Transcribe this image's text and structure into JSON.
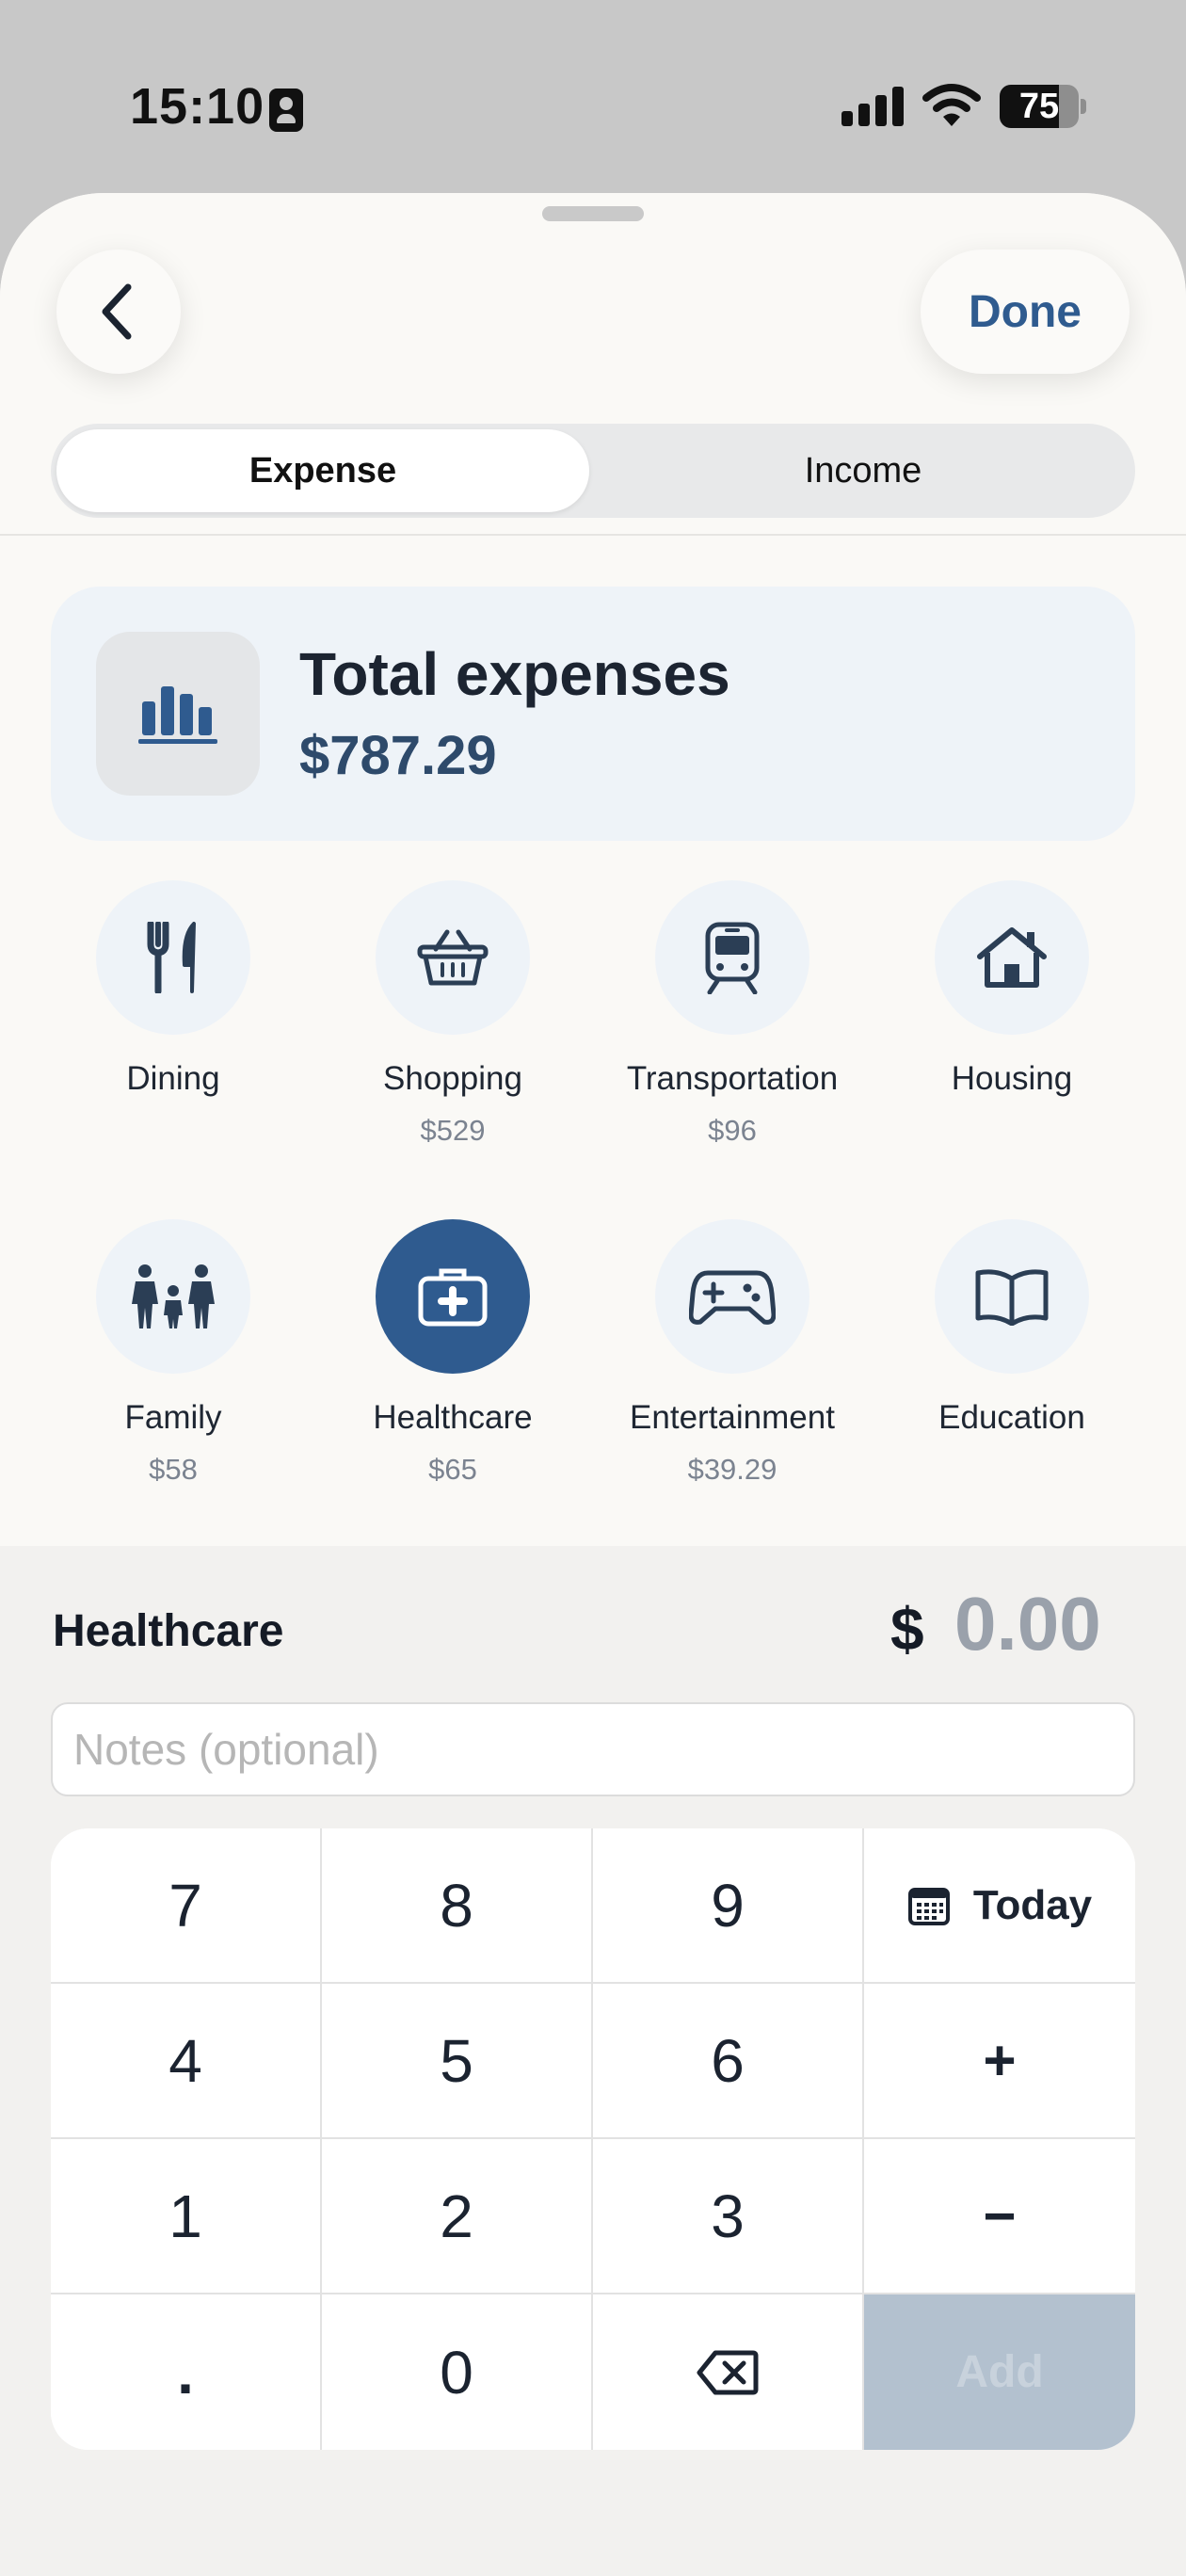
{
  "status": {
    "time": "15:10",
    "battery": "75",
    "battery_level": 0.75,
    "icons": [
      "id-card-icon",
      "signal-icon",
      "wifi-icon",
      "battery-icon"
    ]
  },
  "header": {
    "back_icon": "chevron-left-icon",
    "done_label": "Done"
  },
  "tabs": [
    {
      "label": "Expense",
      "active": true
    },
    {
      "label": "Income",
      "active": false
    }
  ],
  "summary": {
    "icon": "bar-chart-icon",
    "title": "Total expenses",
    "amount": "$787.29"
  },
  "categories": [
    {
      "label": "Dining",
      "amount": "",
      "icon": "fork-knife-icon"
    },
    {
      "label": "Shopping",
      "amount": "$529",
      "icon": "basket-icon"
    },
    {
      "label": "Transportation",
      "amount": "$96",
      "icon": "train-icon"
    },
    {
      "label": "Housing",
      "amount": "",
      "icon": "house-icon"
    },
    {
      "label": "Family",
      "amount": "$58",
      "icon": "family-icon"
    },
    {
      "label": "Healthcare",
      "amount": "$65",
      "icon": "medical-kit-icon",
      "selected": true
    },
    {
      "label": "Entertainment",
      "amount": "$39.29",
      "icon": "gamepad-icon"
    },
    {
      "label": "Education",
      "amount": "",
      "icon": "book-icon"
    }
  ],
  "entry": {
    "category": "Healthcare",
    "currency": "$",
    "amount": "0.00",
    "notes_placeholder": "Notes (optional)",
    "notes_value": ""
  },
  "keypad": {
    "k7": "7",
    "k8": "8",
    "k9": "9",
    "today": "Today",
    "k4": "4",
    "k5": "5",
    "k6": "6",
    "plus": "+",
    "k1": "1",
    "k2": "2",
    "k3": "3",
    "minus": "−",
    "dot": ".",
    "k0": "0",
    "add": "Add",
    "today_icon": "calendar-icon",
    "backspace_icon": "backspace-icon"
  },
  "colors": {
    "accent": "#2f5b8f",
    "card_bg": "#eef3f8",
    "add_disabled": "#b3c1cf"
  }
}
